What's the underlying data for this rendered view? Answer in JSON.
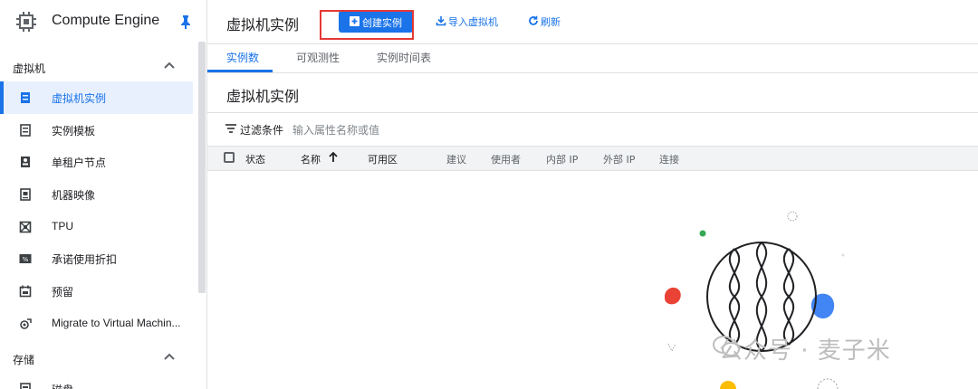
{
  "sidebar": {
    "product_name": "Compute Engine",
    "sections": [
      {
        "title": "虚拟机",
        "items": [
          {
            "label": "虚拟机实例",
            "icon": "vm-instance-icon",
            "active": true
          },
          {
            "label": "实例模板",
            "icon": "instance-template-icon"
          },
          {
            "label": "单租户节点",
            "icon": "sole-tenant-node-icon"
          },
          {
            "label": "机器映像",
            "icon": "machine-image-icon"
          },
          {
            "label": "TPU",
            "icon": "tpu-icon"
          },
          {
            "label": "承诺使用折扣",
            "icon": "committed-use-discount-icon"
          },
          {
            "label": "预留",
            "icon": "reservation-icon"
          },
          {
            "label": "Migrate to Virtual Machin...",
            "icon": "migrate-icon"
          }
        ]
      },
      {
        "title": "存储",
        "items": [
          {
            "label": "磁盘",
            "icon": "disk-icon"
          }
        ]
      }
    ]
  },
  "header": {
    "title": "虚拟机实例",
    "create_button": "创建实例",
    "import_button": "导入虚拟机",
    "refresh_button": "刷新"
  },
  "tabs": [
    {
      "label": "实例数",
      "active": true
    },
    {
      "label": "可观测性"
    },
    {
      "label": "实例时间表"
    }
  ],
  "content": {
    "section_title": "虚拟机实例",
    "filter_label": "过滤条件",
    "filter_placeholder": "输入属性名称或值",
    "columns": [
      "状态",
      "名称",
      "可用区",
      "建议",
      "使用者",
      "内部 IP",
      "外部 IP",
      "连接"
    ],
    "sort_column": "名称",
    "sort_direction": "ascending"
  },
  "watermark": "公众号 · 麦子米",
  "colors": {
    "accent": "#1a73e8",
    "highlight_box": "#e53935",
    "active_nav_bg": "#e8f0fe"
  }
}
